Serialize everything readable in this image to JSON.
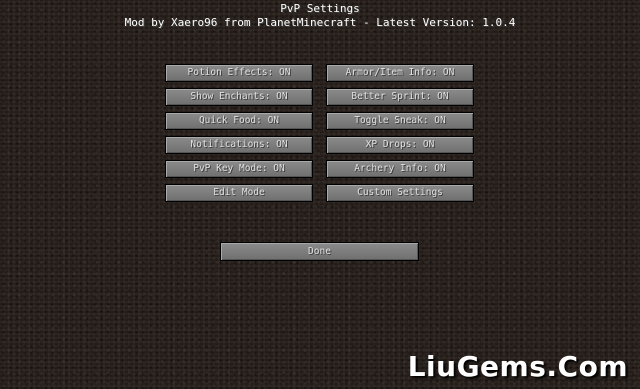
{
  "header": {
    "title": "PvP Settings",
    "subtitle": "Mod by Xaero96 from PlanetMinecraft - Latest Version: 1.0.4"
  },
  "buttons": {
    "left": [
      "Potion Effects: ON",
      "Show Enchants: ON",
      "Quick Food: ON",
      "Notifications: ON",
      "PvP Key Mode: ON",
      "Edit Mode"
    ],
    "right": [
      "Armor/Item Info: ON",
      "Better Sprint: ON",
      "Toggle Sneak: ON",
      "XP Drops: ON",
      "Archery Info: ON",
      "Custom Settings"
    ],
    "done": "Done"
  },
  "watermark": "LiuGems.Com"
}
